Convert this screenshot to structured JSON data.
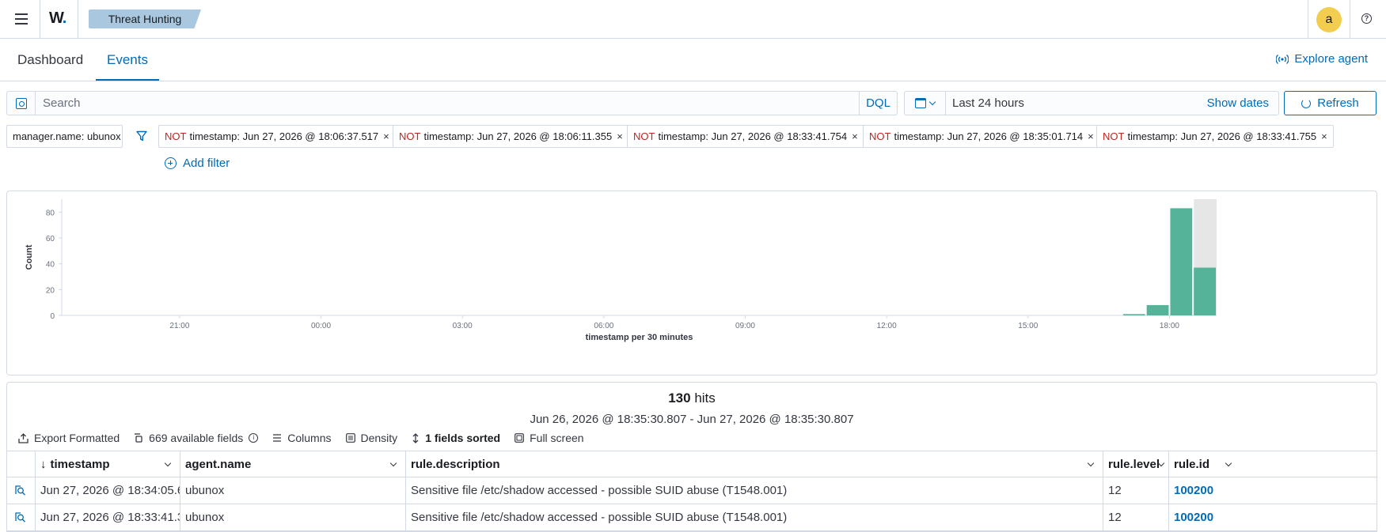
{
  "header": {
    "logo_text": "W",
    "logo_dot": ".",
    "breadcrumb": "Threat Hunting",
    "avatar_letter": "a",
    "help_glyph": "?"
  },
  "tabs": [
    {
      "label": "Dashboard",
      "active": false
    },
    {
      "label": "Events",
      "active": true
    }
  ],
  "explore_agent": "Explore agent",
  "query": {
    "placeholder": "Search",
    "value": "",
    "language": "DQL"
  },
  "date": {
    "range": "Last 24 hours",
    "show_dates": "Show dates",
    "refresh": "Refresh"
  },
  "filters": {
    "index_filter": "manager.name: ubunox",
    "not_label": "NOT",
    "close_glyph": "×",
    "items": [
      "timestamp: Jun 27, 2026 @ 18:06:37.517",
      "timestamp: Jun 27, 2026 @ 18:06:11.355",
      "timestamp: Jun 27, 2026 @ 18:33:41.754",
      "timestamp: Jun 27, 2026 @ 18:35:01.714",
      "timestamp: Jun 27, 2026 @ 18:33:41.755"
    ],
    "add_filter": "Add filter"
  },
  "chart_data": {
    "type": "bar",
    "title": "",
    "xlabel": "timestamp per 30 minutes",
    "ylabel": "Count",
    "ylim": [
      0,
      90
    ],
    "yticks": [
      0,
      20,
      40,
      60,
      80
    ],
    "x_tick_labels": [
      "21:00",
      "00:00",
      "03:00",
      "06:00",
      "09:00",
      "12:00",
      "15:00",
      "18:00"
    ],
    "x_range": [
      "Jun 26 18:30",
      "Jun 27 19:00"
    ],
    "bar_interval_minutes": 30,
    "series": [
      {
        "values": [
          {
            "x": "Jun 27 17:00",
            "y": 1
          },
          {
            "x": "Jun 27 17:30",
            "y": 8
          },
          {
            "x": "Jun 27 18:00",
            "y": 83
          },
          {
            "x": "Jun 27 18:30",
            "y": 37
          }
        ]
      }
    ],
    "partial_bucket": {
      "x": "Jun 27 18:30",
      "shaded": true
    },
    "colors": {
      "bar": "#54b399",
      "partial": "#e6e6e6",
      "axis": "#d3dae6"
    },
    "grid": false
  },
  "results": {
    "hits_count": "130",
    "hits_label": "hits",
    "range": "Jun 26, 2026 @ 18:35:30.807 - Jun 27, 2026 @ 18:35:30.807",
    "toolbar": {
      "export": "Export Formatted",
      "fields": "669 available fields",
      "columns": "Columns",
      "density": "Density",
      "sorted": "1 fields sorted",
      "fullscreen": "Full screen"
    },
    "columns": [
      "timestamp",
      "agent.name",
      "rule.description",
      "rule.level",
      "rule.id"
    ],
    "rows": [
      {
        "timestamp": "Jun 27, 2026 @ 18:34:05.6...",
        "agent": "ubunox",
        "description": "Sensitive file /etc/shadow accessed - possible SUID abuse (T1548.001)",
        "level": "12",
        "id": "100200"
      },
      {
        "timestamp": "Jun 27, 2026 @ 18:33:41.3...",
        "agent": "ubunox",
        "description": "Sensitive file /etc/shadow accessed - possible SUID abuse (T1548.001)",
        "level": "12",
        "id": "100200"
      }
    ]
  },
  "colors": {
    "accent": "#006bb8",
    "danger": "#bd271e",
    "avatar": "#f3cd4f",
    "breadcrumb": "#a9c8e0"
  }
}
